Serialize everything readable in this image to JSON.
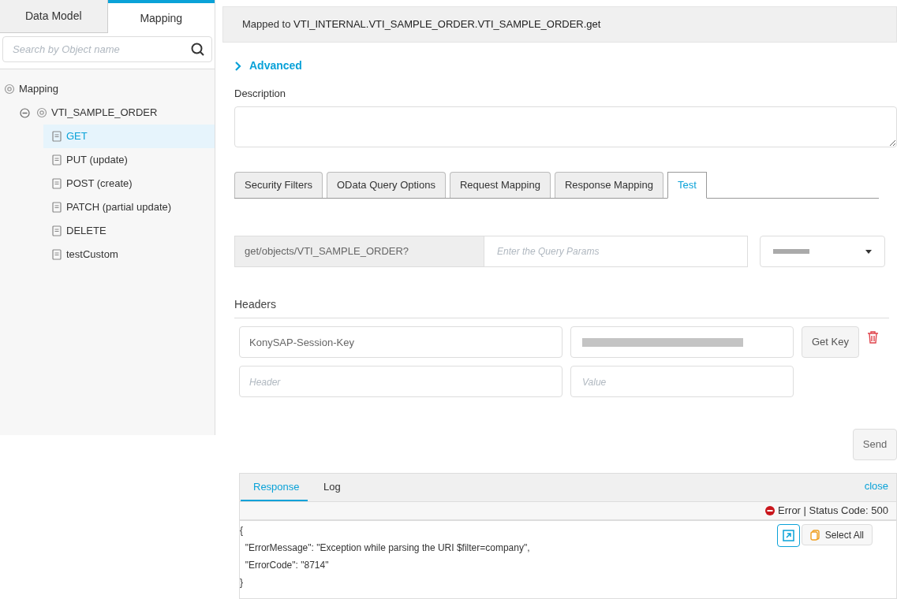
{
  "sidebar": {
    "tabs": [
      {
        "label": "Data Model",
        "selected": false
      },
      {
        "label": "Mapping",
        "selected": true
      }
    ],
    "search": {
      "placeholder": "Search by Object name"
    },
    "tree": [
      {
        "label": "Mapping",
        "kind": "root",
        "children": [
          {
            "label": "VTI_SAMPLE_ORDER",
            "kind": "object",
            "expanded": true,
            "children": [
              {
                "label": "GET",
                "kind": "method",
                "selected": true
              },
              {
                "label": "PUT (update)",
                "kind": "method",
                "selected": false
              },
              {
                "label": "POST (create)",
                "kind": "method",
                "selected": false
              },
              {
                "label": "PATCH (partial update)",
                "kind": "method",
                "selected": false
              },
              {
                "label": "DELETE",
                "kind": "method",
                "selected": false
              },
              {
                "label": "testCustom",
                "kind": "method",
                "selected": false
              }
            ]
          }
        ]
      }
    ]
  },
  "mapped_to": {
    "prefix": "Mapped to",
    "target": "VTI_INTERNAL.VTI_SAMPLE_ORDER.VTI_SAMPLE_ORDER.get"
  },
  "advanced": {
    "label": "Advanced",
    "expanded": false
  },
  "description": {
    "label": "Description"
  },
  "tabs": [
    {
      "label": "Security Filters",
      "selected": false
    },
    {
      "label": "OData Query Options",
      "selected": false
    },
    {
      "label": "Request Mapping",
      "selected": false
    },
    {
      "label": "Response Mapping",
      "selected": false
    },
    {
      "label": "Test",
      "selected": true
    }
  ],
  "query": {
    "prefix": "get/objects/VTI_SAMPLE_ORDER?",
    "placeholder": "Enter the Query Params"
  },
  "headers": {
    "label": "Headers",
    "rows": [
      {
        "name": "KonySAP-Session-Key",
        "value_redacted": true
      },
      {
        "key_placeholder": "Header",
        "value_placeholder": "Value",
        "value_redacted": false
      }
    ],
    "get_key": "Get Key"
  },
  "send": "Send",
  "response": {
    "tabs": [
      {
        "label": "Response",
        "selected": true
      },
      {
        "label": "Log",
        "selected": false
      }
    ],
    "close": "close",
    "status": "Error | Status Code: 500",
    "select_all": "Select All",
    "body": [
      "{",
      "  \"ErrorMessage\": \"Exception while parsing the URI $filter=company\",",
      "  \"ErrorCode\": \"8714\"",
      "}"
    ]
  }
}
